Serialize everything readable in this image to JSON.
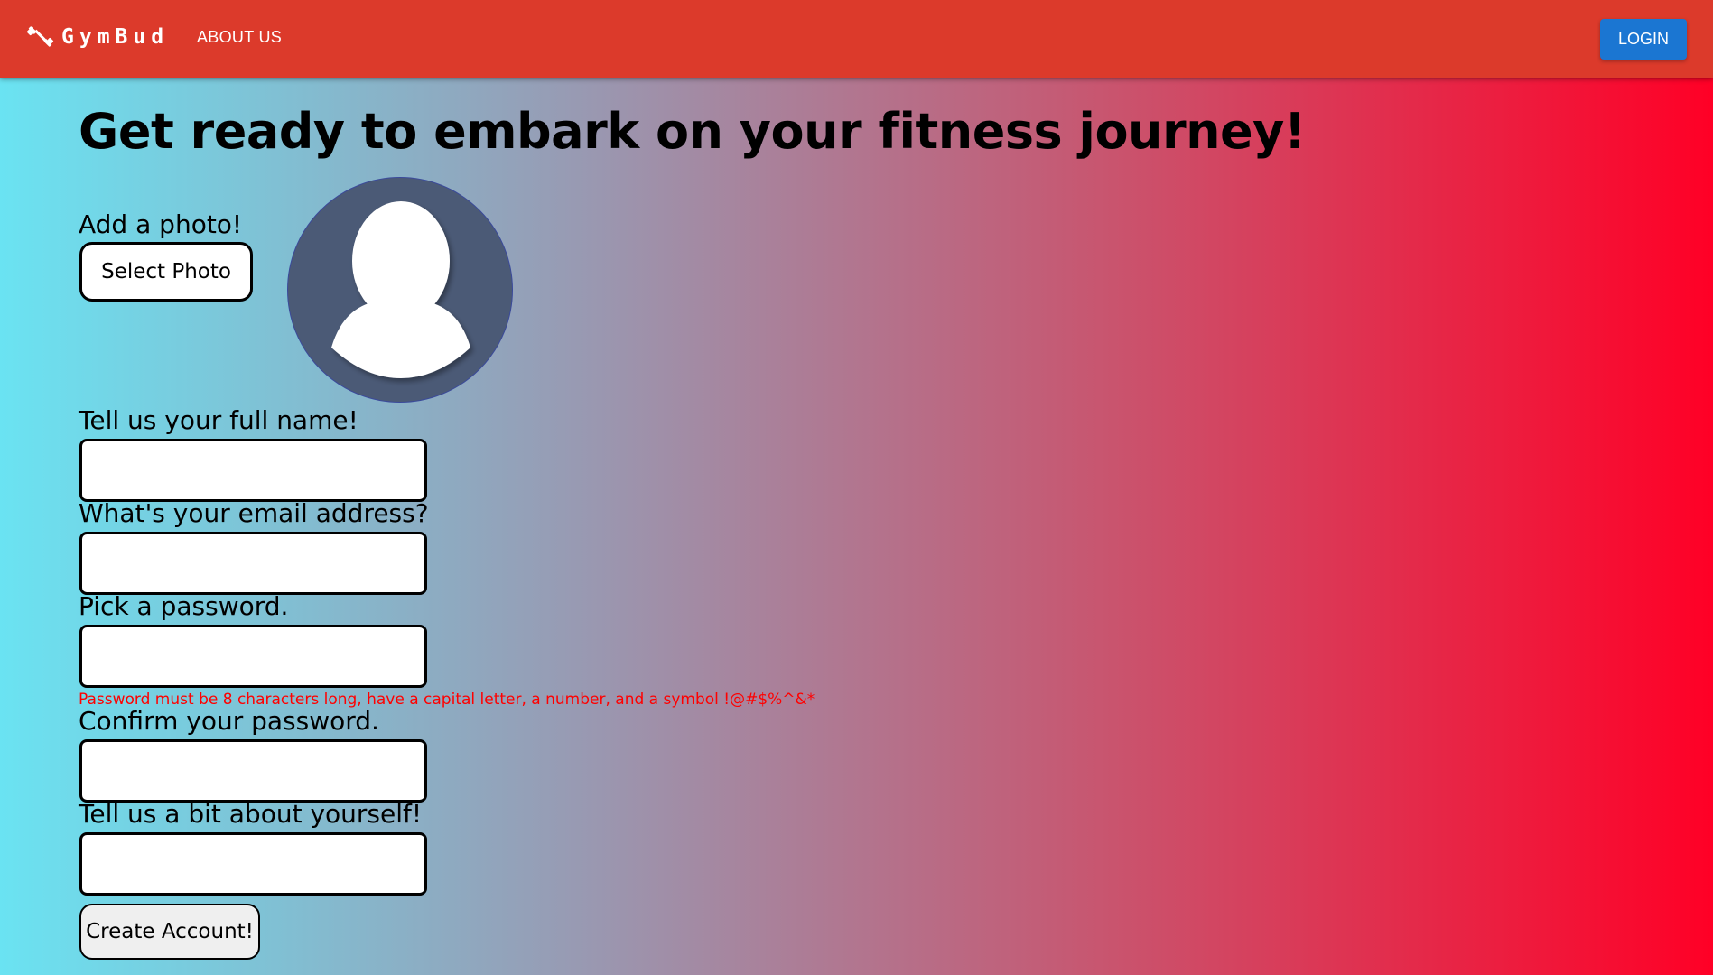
{
  "nav": {
    "brand": "GymBud",
    "brand_icon": "dumbbell-icon",
    "about_label": "ABOUT US",
    "login_label": "LOGIN",
    "colors": {
      "bar": "#dc3a2b",
      "login_button": "#1b76d2"
    }
  },
  "page": {
    "headline": "Get ready to embark on your fitness journey!",
    "background_gradient": [
      "#6ae3f2",
      "#ff0026"
    ]
  },
  "photo": {
    "label": "Add a photo!",
    "button_label": "Select Photo",
    "avatar_icon": "default-user-avatar-icon"
  },
  "form": {
    "full_name": {
      "label": "Tell us your full name!",
      "value": ""
    },
    "email": {
      "label": "What's your email address?",
      "value": ""
    },
    "password": {
      "label": "Pick a password.",
      "value": "",
      "hint": "Password must be 8 characters long, have a capital letter, a number, and a symbol !@#$%^&*"
    },
    "confirm_password": {
      "label": "Confirm your password.",
      "value": ""
    },
    "about": {
      "label": "Tell us a bit about yourself!",
      "value": ""
    },
    "submit_label": "Create Account!",
    "hint_color": "#ff0000"
  }
}
